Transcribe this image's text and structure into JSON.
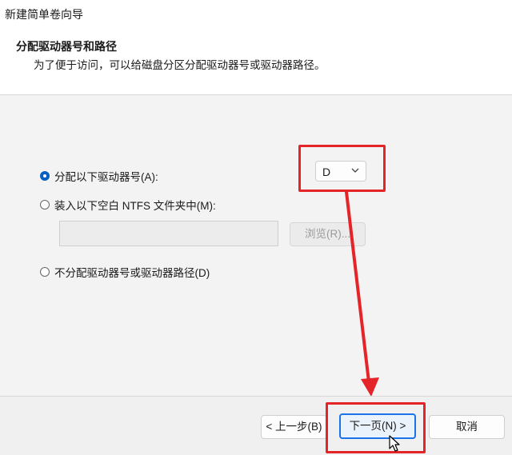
{
  "window": {
    "title": "新建简单卷向导"
  },
  "header": {
    "title": "分配驱动器号和路径",
    "subtitle": "为了便于访问，可以给磁盘分区分配驱动器号或驱动器路径。"
  },
  "options": {
    "assign_letter": {
      "label": "分配以下驱动器号(A):",
      "checked": true
    },
    "mount_folder": {
      "label": "装入以下空白 NTFS 文件夹中(M):",
      "checked": false
    },
    "no_assign": {
      "label": "不分配驱动器号或驱动器路径(D)",
      "checked": false
    }
  },
  "drive_select": {
    "value": "D",
    "icon": "chevron-down-icon"
  },
  "folder_path": {
    "value": ""
  },
  "browse_button": {
    "label": "浏览(R)..."
  },
  "footer": {
    "back_label": "< 上一步(B)",
    "next_label": "下一页(N) >",
    "cancel_label": "取消"
  },
  "colors": {
    "annotation_red": "#e5242a",
    "accent_blue": "#0a5fc2"
  }
}
